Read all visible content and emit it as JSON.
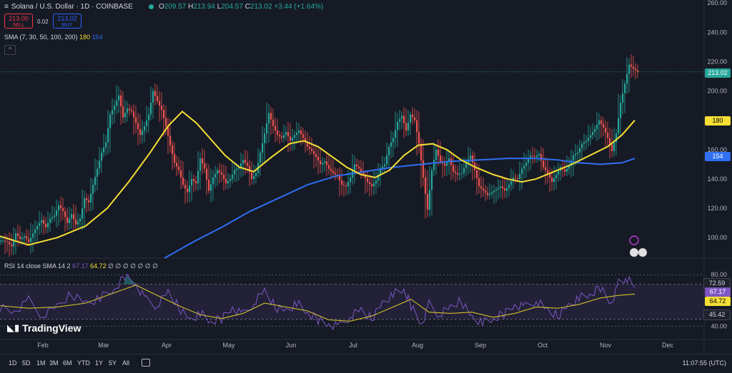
{
  "header": {
    "symbol": "Solana / U.S. Dollar · 1D · COINBASE",
    "open_label": "O",
    "open": "209.57",
    "high_label": "H",
    "high": "213.94",
    "low_label": "L",
    "low": "204.57",
    "close_label": "C",
    "close": "213.02",
    "change": "+3.44 (+1.64%)"
  },
  "trade": {
    "sell_price": "213.00",
    "sell_label": "SELL",
    "spread": "0.02",
    "buy_price": "213.02",
    "buy_label": "BUY"
  },
  "sma_legend": {
    "label": "SMA (7, 30, 50, 100, 200)",
    "v1": "180",
    "v2": "154"
  },
  "collapse_icon": "^",
  "rsi_legend": {
    "label": "RSI 14 close SMA 14 2",
    "v1": "67.17",
    "v2": "64.72",
    "rest": "∅ ∅ ∅ ∅ ∅ ∅ ∅"
  },
  "logo": "TradingView",
  "price_labels": {
    "last": "213.02",
    "sma_a": "180",
    "sma_b": "154"
  },
  "rsi_labels": {
    "upper": "72.59",
    "rsi": "67.17",
    "sma": "64.72",
    "lower": "45.42"
  },
  "timeframes": [
    "1D",
    "5D",
    "1M",
    "3M",
    "6M",
    "YTD",
    "1Y",
    "5Y",
    "All"
  ],
  "clock": "11:07:55 (UTC)",
  "colors": {
    "up": "#26a69a",
    "down": "#ef5350",
    "sma_yellow": "#f5de35",
    "sma_blue": "#2f6ff0",
    "rsi": "#7e57c2",
    "bg": "#161a25"
  },
  "chart_data": {
    "type": "candlestick",
    "title": "Solana / U.S. Dollar · 1D · COINBASE",
    "price_axis_ticks": [
      100,
      120,
      140,
      160,
      180,
      200,
      220,
      240,
      260
    ],
    "ylim": [
      86,
      262
    ],
    "x_ticks": [
      "Feb",
      "Mar",
      "Apr",
      "May",
      "Jun",
      "Jul",
      "Aug",
      "Sep",
      "Oct",
      "Nov",
      "Dec"
    ],
    "last_price": 213.02,
    "close_path": [
      [
        0,
        98
      ],
      [
        6,
        97
      ],
      [
        12,
        94
      ],
      [
        18,
        103
      ],
      [
        24,
        99
      ],
      [
        30,
        101
      ],
      [
        36,
        97
      ],
      [
        42,
        103
      ],
      [
        48,
        108
      ],
      [
        54,
        112
      ],
      [
        60,
        107
      ],
      [
        66,
        113
      ],
      [
        72,
        115
      ],
      [
        78,
        122
      ],
      [
        84,
        118
      ],
      [
        90,
        110
      ],
      [
        96,
        116
      ],
      [
        102,
        109
      ],
      [
        108,
        113
      ],
      [
        114,
        127
      ],
      [
        120,
        124
      ],
      [
        126,
        136
      ],
      [
        132,
        147
      ],
      [
        138,
        158
      ],
      [
        144,
        165
      ],
      [
        150,
        184
      ],
      [
        156,
        190
      ],
      [
        162,
        197
      ],
      [
        168,
        182
      ],
      [
        174,
        188
      ],
      [
        180,
        186
      ],
      [
        186,
        178
      ],
      [
        192,
        170
      ],
      [
        198,
        176
      ],
      [
        204,
        184
      ],
      [
        210,
        200
      ],
      [
        216,
        193
      ],
      [
        222,
        187
      ],
      [
        228,
        176
      ],
      [
        234,
        163
      ],
      [
        240,
        151
      ],
      [
        246,
        146
      ],
      [
        252,
        136
      ],
      [
        258,
        131
      ],
      [
        264,
        140
      ],
      [
        270,
        137
      ],
      [
        276,
        154
      ],
      [
        282,
        147
      ],
      [
        288,
        132
      ],
      [
        294,
        141
      ],
      [
        300,
        146
      ],
      [
        306,
        143
      ],
      [
        312,
        137
      ],
      [
        318,
        140
      ],
      [
        324,
        146
      ],
      [
        330,
        148
      ],
      [
        336,
        153
      ],
      [
        342,
        149
      ],
      [
        348,
        140
      ],
      [
        354,
        144
      ],
      [
        360,
        158
      ],
      [
        366,
        171
      ],
      [
        372,
        185
      ],
      [
        378,
        176
      ],
      [
        384,
        170
      ],
      [
        390,
        168
      ],
      [
        396,
        172
      ],
      [
        402,
        166
      ],
      [
        408,
        170
      ],
      [
        414,
        173
      ],
      [
        420,
        168
      ],
      [
        426,
        162
      ],
      [
        432,
        159
      ],
      [
        438,
        155
      ],
      [
        444,
        150
      ],
      [
        450,
        152
      ],
      [
        456,
        147
      ],
      [
        462,
        144
      ],
      [
        468,
        142
      ],
      [
        474,
        136
      ],
      [
        480,
        135
      ],
      [
        486,
        141
      ],
      [
        492,
        150
      ],
      [
        498,
        147
      ],
      [
        504,
        143
      ],
      [
        510,
        138
      ],
      [
        516,
        135
      ],
      [
        522,
        139
      ],
      [
        528,
        147
      ],
      [
        534,
        150
      ],
      [
        540,
        162
      ],
      [
        546,
        168
      ],
      [
        552,
        179
      ],
      [
        558,
        183
      ],
      [
        564,
        173
      ],
      [
        570,
        184
      ],
      [
        576,
        180
      ],
      [
        582,
        164
      ],
      [
        588,
        141
      ],
      [
        594,
        119
      ],
      [
        600,
        146
      ],
      [
        606,
        160
      ],
      [
        612,
        152
      ],
      [
        618,
        149
      ],
      [
        624,
        154
      ],
      [
        630,
        145
      ],
      [
        636,
        143
      ],
      [
        642,
        144
      ],
      [
        648,
        151
      ],
      [
        654,
        156
      ],
      [
        660,
        146
      ],
      [
        666,
        135
      ],
      [
        672,
        132
      ],
      [
        678,
        129
      ],
      [
        684,
        131
      ],
      [
        690,
        133
      ],
      [
        696,
        135
      ],
      [
        702,
        132
      ],
      [
        708,
        136
      ],
      [
        714,
        141
      ],
      [
        720,
        140
      ],
      [
        726,
        147
      ],
      [
        732,
        151
      ],
      [
        738,
        156
      ],
      [
        744,
        155
      ],
      [
        750,
        157
      ],
      [
        756,
        148
      ],
      [
        762,
        144
      ],
      [
        768,
        138
      ],
      [
        774,
        143
      ],
      [
        780,
        148
      ],
      [
        786,
        145
      ],
      [
        792,
        149
      ],
      [
        798,
        156
      ],
      [
        804,
        158
      ],
      [
        810,
        164
      ],
      [
        816,
        166
      ],
      [
        822,
        170
      ],
      [
        828,
        174
      ],
      [
        834,
        180
      ],
      [
        840,
        175
      ],
      [
        846,
        168
      ],
      [
        852,
        159
      ],
      [
        858,
        171
      ],
      [
        864,
        192
      ],
      [
        870,
        205
      ],
      [
        876,
        218
      ],
      [
        882,
        215
      ],
      [
        888,
        213
      ]
    ],
    "sma_yellow": [
      [
        0,
        101
      ],
      [
        40,
        95
      ],
      [
        80,
        100
      ],
      [
        120,
        108
      ],
      [
        150,
        120
      ],
      [
        180,
        138
      ],
      [
        210,
        158
      ],
      [
        235,
        176
      ],
      [
        255,
        186
      ],
      [
        275,
        178
      ],
      [
        295,
        167
      ],
      [
        315,
        156
      ],
      [
        335,
        148
      ],
      [
        355,
        145
      ],
      [
        380,
        155
      ],
      [
        405,
        164
      ],
      [
        425,
        166
      ],
      [
        445,
        162
      ],
      [
        465,
        155
      ],
      [
        485,
        148
      ],
      [
        505,
        143
      ],
      [
        525,
        141
      ],
      [
        545,
        146
      ],
      [
        565,
        156
      ],
      [
        585,
        163
      ],
      [
        605,
        164
      ],
      [
        625,
        160
      ],
      [
        645,
        153
      ],
      [
        665,
        148
      ],
      [
        690,
        143
      ],
      [
        710,
        140
      ],
      [
        730,
        138
      ],
      [
        750,
        140
      ],
      [
        775,
        145
      ],
      [
        800,
        150
      ],
      [
        825,
        156
      ],
      [
        850,
        162
      ],
      [
        870,
        170
      ],
      [
        888,
        180
      ]
    ],
    "sma_blue": [
      [
        230,
        86
      ],
      [
        270,
        97
      ],
      [
        310,
        107
      ],
      [
        350,
        118
      ],
      [
        390,
        127
      ],
      [
        430,
        136
      ],
      [
        470,
        142
      ],
      [
        510,
        145
      ],
      [
        550,
        148
      ],
      [
        590,
        150
      ],
      [
        630,
        152
      ],
      [
        670,
        153
      ],
      [
        710,
        154
      ],
      [
        750,
        154
      ],
      [
        780,
        153
      ],
      [
        810,
        151
      ],
      [
        840,
        150
      ],
      [
        870,
        151
      ],
      [
        888,
        154
      ]
    ],
    "rsi": {
      "ticks": [
        40,
        80
      ],
      "ylim": [
        32,
        84
      ],
      "upper_band": 72.59,
      "lower_band": 45.42,
      "rsi_last": 67.17,
      "sma_last": 64.72,
      "series": [
        [
          0,
          55
        ],
        [
          20,
          52
        ],
        [
          40,
          60
        ],
        [
          60,
          48
        ],
        [
          80,
          55
        ],
        [
          100,
          65
        ],
        [
          120,
          58
        ],
        [
          140,
          62
        ],
        [
          160,
          68
        ],
        [
          175,
          79
        ],
        [
          190,
          73
        ],
        [
          205,
          60
        ],
        [
          220,
          56
        ],
        [
          235,
          66
        ],
        [
          250,
          55
        ],
        [
          265,
          45
        ],
        [
          280,
          50
        ],
        [
          295,
          43
        ],
        [
          310,
          46
        ],
        [
          325,
          55
        ],
        [
          340,
          49
        ],
        [
          355,
          58
        ],
        [
          370,
          67
        ],
        [
          385,
          55
        ],
        [
          400,
          52
        ],
        [
          415,
          58
        ],
        [
          430,
          50
        ],
        [
          445,
          45
        ],
        [
          460,
          42
        ],
        [
          475,
          40
        ],
        [
          490,
          48
        ],
        [
          505,
          52
        ],
        [
          520,
          46
        ],
        [
          535,
          58
        ],
        [
          550,
          65
        ],
        [
          565,
          68
        ],
        [
          575,
          56
        ],
        [
          590,
          42
        ],
        [
          600,
          57
        ],
        [
          615,
          49
        ],
        [
          630,
          54
        ],
        [
          645,
          60
        ],
        [
          660,
          47
        ],
        [
          675,
          43
        ],
        [
          690,
          45
        ],
        [
          705,
          50
        ],
        [
          720,
          57
        ],
        [
          735,
          55
        ],
        [
          750,
          60
        ],
        [
          765,
          52
        ],
        [
          780,
          48
        ],
        [
          795,
          56
        ],
        [
          810,
          62
        ],
        [
          825,
          64
        ],
        [
          840,
          70
        ],
        [
          855,
          58
        ],
        [
          865,
          73
        ],
        [
          875,
          78
        ],
        [
          888,
          70
        ]
      ],
      "sma": [
        [
          0,
          56
        ],
        [
          40,
          54
        ],
        [
          80,
          55
        ],
        [
          120,
          58
        ],
        [
          160,
          66
        ],
        [
          190,
          72
        ],
        [
          220,
          64
        ],
        [
          250,
          56
        ],
        [
          280,
          49
        ],
        [
          310,
          46
        ],
        [
          340,
          50
        ],
        [
          370,
          58
        ],
        [
          400,
          55
        ],
        [
          430,
          52
        ],
        [
          460,
          45
        ],
        [
          490,
          44
        ],
        [
          520,
          48
        ],
        [
          550,
          55
        ],
        [
          575,
          61
        ],
        [
          600,
          51
        ],
        [
          630,
          50
        ],
        [
          660,
          51
        ],
        [
          690,
          47
        ],
        [
          720,
          50
        ],
        [
          750,
          55
        ],
        [
          780,
          54
        ],
        [
          810,
          57
        ],
        [
          840,
          62
        ],
        [
          865,
          64
        ],
        [
          888,
          65
        ]
      ]
    }
  }
}
